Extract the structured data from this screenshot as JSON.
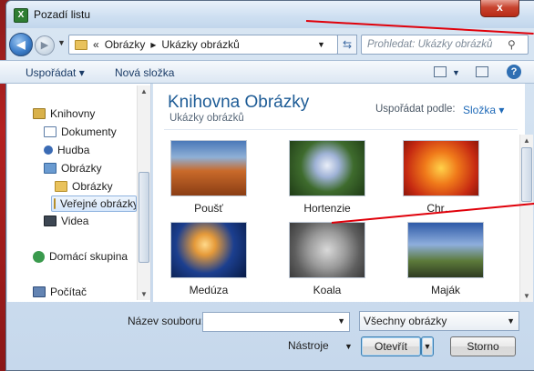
{
  "window": {
    "title": "Pozadí listu",
    "close": "x"
  },
  "nav": {
    "breadcrumb": [
      "«",
      "Obrázky",
      "▸",
      "Ukázky obrázků"
    ],
    "search_placeholder": "Prohledat: Ukázky obrázků"
  },
  "toolbar": {
    "organize": "Uspořádat ▾",
    "new_folder": "Nová složka"
  },
  "sidebar": {
    "items": [
      {
        "label": "Knihovny"
      },
      {
        "label": "Dokumenty"
      },
      {
        "label": "Hudba"
      },
      {
        "label": "Obrázky"
      },
      {
        "label": "Obrázky"
      },
      {
        "label": "Veřejné obrázky"
      },
      {
        "label": "Videa"
      },
      {
        "label": "Domácí skupina"
      },
      {
        "label": "Počítač"
      }
    ]
  },
  "library": {
    "title": "Knihovna Obrázky",
    "subtitle": "Ukázky obrázků",
    "arrange_label": "Uspořádat podle:",
    "arrange_value": "Složka ▾"
  },
  "files": [
    {
      "name": "Poušť"
    },
    {
      "name": "Hortenzie"
    },
    {
      "name": "Chr…"
    },
    {
      "name": "Medúza"
    },
    {
      "name": "Koala"
    },
    {
      "name": "Maják"
    }
  ],
  "footer": {
    "filename_label": "Název souboru:",
    "filename_value": "",
    "filetype_value": "Všechny obrázky",
    "tools_label": "Nástroje",
    "open_label": "Otevřít",
    "cancel_label": "Storno"
  }
}
